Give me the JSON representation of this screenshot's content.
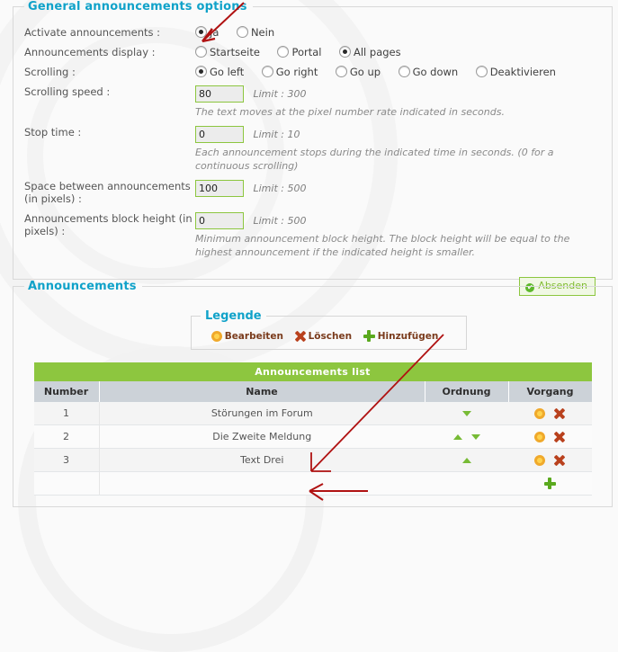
{
  "general": {
    "legend": "General announcements options",
    "rows": [
      {
        "label": "Activate announcements :",
        "type": "radio",
        "options": [
          {
            "label": "Ja",
            "selected": true
          },
          {
            "label": "Nein",
            "selected": false
          }
        ]
      },
      {
        "label": "Announcements display :",
        "type": "radio",
        "options": [
          {
            "label": "Startseite",
            "selected": false
          },
          {
            "label": "Portal",
            "selected": false
          },
          {
            "label": "All pages",
            "selected": true
          }
        ]
      },
      {
        "label": "Scrolling :",
        "type": "radio",
        "options": [
          {
            "label": "Go left",
            "selected": true
          },
          {
            "label": "Go right",
            "selected": false
          },
          {
            "label": "Go up",
            "selected": false
          },
          {
            "label": "Go down",
            "selected": false
          },
          {
            "label": "Deaktivieren",
            "selected": false
          }
        ]
      },
      {
        "label": "Scrolling speed :",
        "type": "number",
        "value": "80",
        "limit": "Limit : 300",
        "hint": "The text moves at the pixel number rate indicated in seconds."
      },
      {
        "label": "Stop time :",
        "type": "number",
        "value": "0",
        "limit": "Limit : 10",
        "hint": "Each announcement stops during the indicated time in seconds. (0 for a continuous scrolling)"
      },
      {
        "label": "Space between announcements (in pixels) :",
        "type": "number",
        "value": "100",
        "limit": "Limit : 500",
        "hint": ""
      },
      {
        "label": "Announcements block height (in pixels) :",
        "type": "number",
        "value": "0",
        "limit": "Limit : 500",
        "hint": "Minimum announcement block height. The block height will be equal to the highest announcement if the indicated height is smaller."
      }
    ],
    "submit_label": "Absenden",
    "submit_check": "✔"
  },
  "announcements": {
    "legend": "Announcements",
    "legende": {
      "legend": "Legende",
      "items": [
        {
          "icon": "edit-icon",
          "label": "Bearbeiten"
        },
        {
          "icon": "delete-icon",
          "label": "Löschen"
        },
        {
          "icon": "add-icon",
          "label": "Hinzufügen"
        }
      ]
    },
    "table": {
      "title": "Announcements list",
      "columns": [
        "Number",
        "Name",
        "Ordnung",
        "Vorgang"
      ],
      "rows": [
        {
          "number": "1",
          "name": "Störungen im Forum",
          "up": false,
          "down": true
        },
        {
          "number": "2",
          "name": "Die Zweite Meldung",
          "up": true,
          "down": true
        },
        {
          "number": "3",
          "name": "Text Drei",
          "up": true,
          "down": false
        }
      ],
      "add_row_icon": "add-icon"
    }
  },
  "colors": {
    "accent_green": "#8dc63f",
    "legend_cyan": "#10a2c9",
    "header_gray": "#ccd2d8",
    "annotation_red": "#b01212",
    "edit_orange": "#ffd24d",
    "delete_red": "#b9411d"
  }
}
